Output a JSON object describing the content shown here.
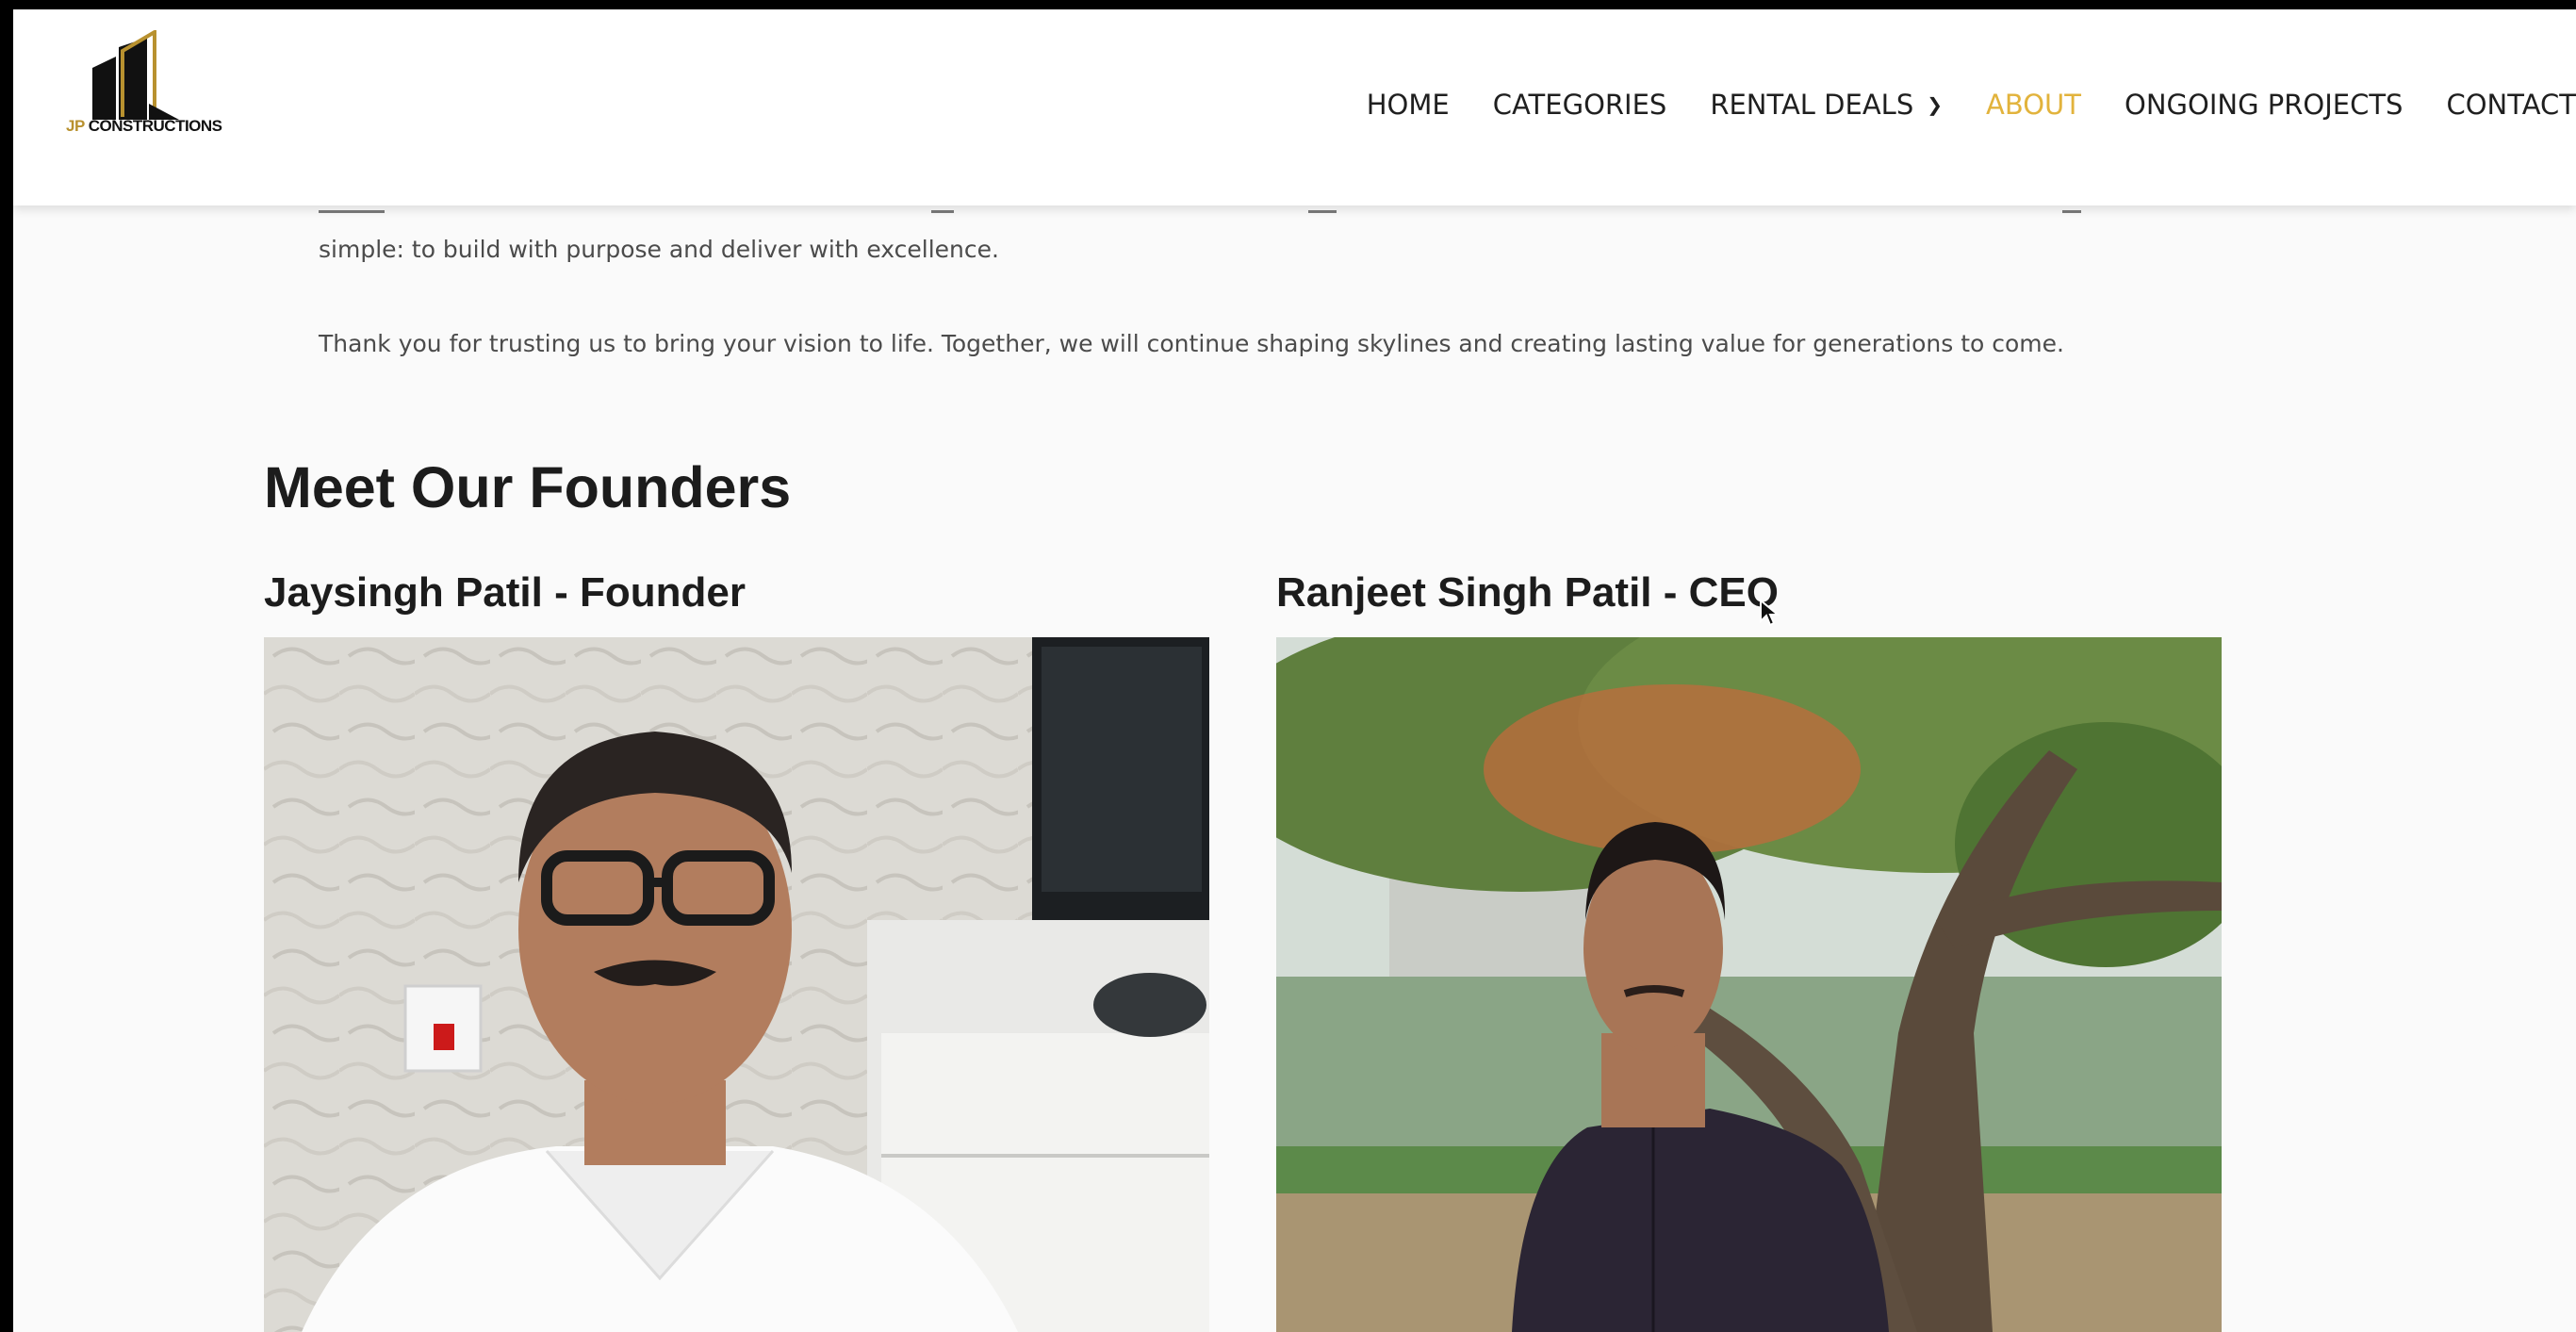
{
  "header": {
    "logo": {
      "text_jp": "JP",
      "text_rest": "CONSTRUCTIONS"
    },
    "nav": [
      {
        "label": "HOME"
      },
      {
        "label": "CATEGORIES"
      },
      {
        "label": "RENTAL DEALS"
      },
      {
        "label": "ABOUT"
      },
      {
        "label": "ONGOING PROJECTS"
      },
      {
        "label": "CONTACT"
      }
    ],
    "active_nav": "ABOUT",
    "accent_color": "#e2b33c"
  },
  "content": {
    "paragraph_1": "simple: to build with purpose and deliver with excellence.",
    "paragraph_2": "Thank you for trusting us to bring your vision to life. Together, we will continue shaping skylines and creating lasting value for generations to come.",
    "section_title": "Meet Our Founders",
    "founders": [
      {
        "name": "Jaysingh Patil - Founder"
      },
      {
        "name": "Ranjeet Singh Patil - CEO"
      }
    ]
  }
}
